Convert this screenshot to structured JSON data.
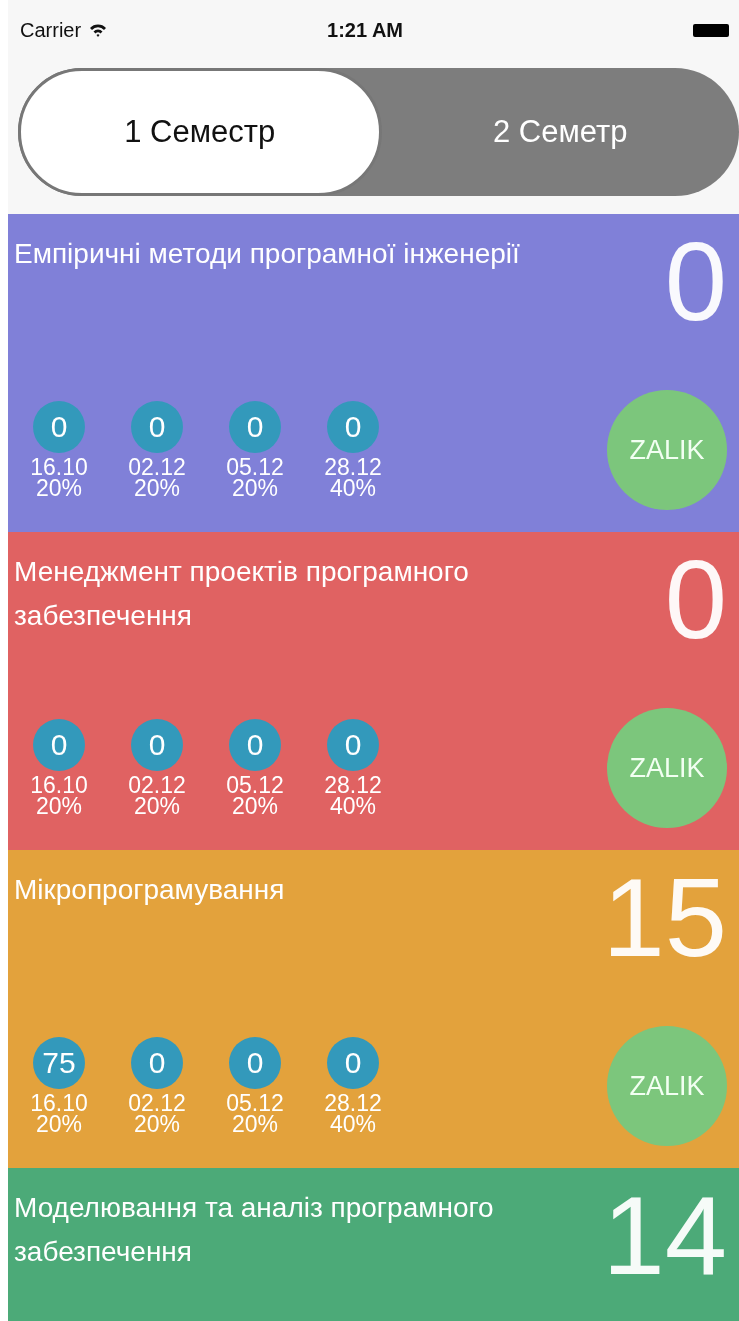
{
  "status_bar": {
    "carrier": "Carrier",
    "time": "1:21 AM"
  },
  "tabs": [
    {
      "label": "1 Семестр",
      "selected": true
    },
    {
      "label": "2 Семетр",
      "selected": false
    }
  ],
  "subjects": [
    {
      "title": "Емпіричні методи програмної інженерії",
      "score": "0",
      "color": "#8080d8",
      "marks": [
        {
          "value": "0",
          "date": "16.10",
          "weight": "20%"
        },
        {
          "value": "0",
          "date": "02.12",
          "weight": "20%"
        },
        {
          "value": "0",
          "date": "05.12",
          "weight": "20%"
        },
        {
          "value": "0",
          "date": "28.12",
          "weight": "40%"
        }
      ],
      "button": "ZALIK"
    },
    {
      "title": "Менеджмент проектів програмного забезпечення",
      "score": "0",
      "color": "#e06262",
      "marks": [
        {
          "value": "0",
          "date": "16.10",
          "weight": "20%"
        },
        {
          "value": "0",
          "date": "02.12",
          "weight": "20%"
        },
        {
          "value": "0",
          "date": "05.12",
          "weight": "20%"
        },
        {
          "value": "0",
          "date": "28.12",
          "weight": "40%"
        }
      ],
      "button": "ZALIK"
    },
    {
      "title": "Мікропрограмування",
      "score": "15",
      "color": "#e3a23c",
      "marks": [
        {
          "value": "75",
          "date": "16.10",
          "weight": "20%"
        },
        {
          "value": "0",
          "date": "02.12",
          "weight": "20%"
        },
        {
          "value": "0",
          "date": "05.12",
          "weight": "20%"
        },
        {
          "value": "0",
          "date": "28.12",
          "weight": "40%"
        }
      ],
      "button": "ZALIK"
    },
    {
      "title": "Моделювання та аналіз програмного забезпечення",
      "score": "14",
      "color": "#4caa78"
    }
  ]
}
